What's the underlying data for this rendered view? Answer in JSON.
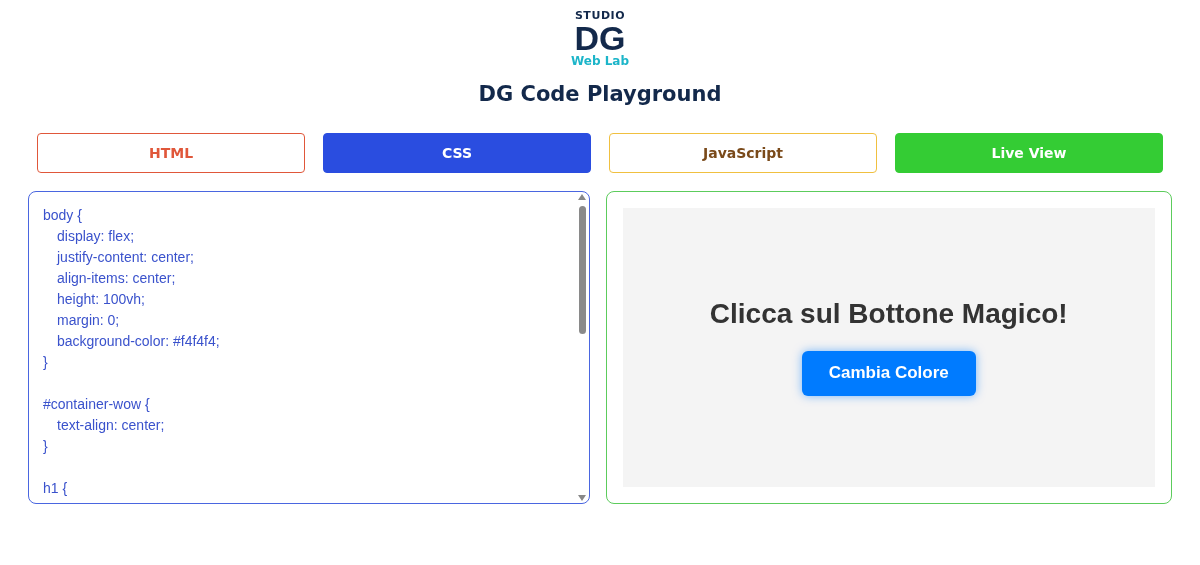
{
  "logo": {
    "top": "STUDIO",
    "mark": "DG",
    "bottom": "Web Lab"
  },
  "title": "DG Code Playground",
  "tabs": [
    {
      "label": "HTML",
      "kind": "tab",
      "selected": false,
      "color": "#e0573a"
    },
    {
      "label": "CSS",
      "kind": "tab",
      "selected": true,
      "color": "#2a4de0"
    },
    {
      "label": "JavaScript",
      "kind": "tab",
      "selected": false,
      "color": "#f0c040"
    },
    {
      "label": "Live View",
      "kind": "action",
      "color": "#34cc34"
    }
  ],
  "editor": {
    "blocks": [
      {
        "open": "body {",
        "declarations": [
          "display: flex;",
          "justify-content: center;",
          "align-items: center;",
          "height: 100vh;",
          "margin: 0;",
          "background-color: #f4f4f4;"
        ],
        "close": "}"
      },
      {
        "open": "#container-wow {",
        "declarations": [
          "text-align: center;"
        ],
        "close": "}"
      },
      {
        "open": "h1 {"
      }
    ]
  },
  "preview": {
    "heading": "Clicca sul Bottone Magico!",
    "button": "Cambia Colore"
  }
}
